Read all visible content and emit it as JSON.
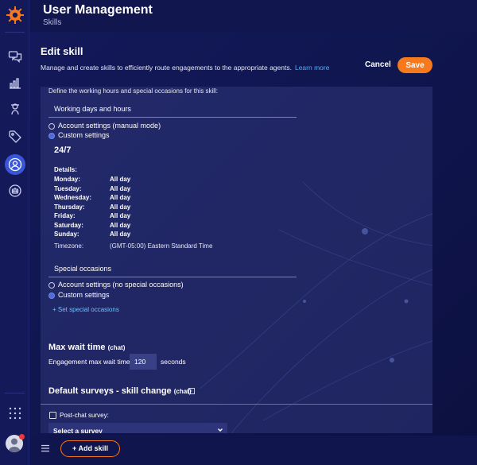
{
  "header": {
    "title": "User Management",
    "subtitle": "Skills"
  },
  "edit": {
    "title": "Edit skill",
    "description": "Manage and create skills to efficiently route engagements to the appropriate agents.",
    "learn_more": "Learn more",
    "cancel_label": "Cancel",
    "save_label": "Save"
  },
  "working_hours": {
    "intro": "Define the working hours and special occasions for this skill:",
    "heading": "Working days and hours",
    "option_account": "Account settings (manual mode)",
    "option_custom": "Custom settings",
    "summary": "24/7",
    "details_label": "Details:",
    "days": [
      {
        "day": "Monday:",
        "value": "All day"
      },
      {
        "day": "Tuesday:",
        "value": "All day"
      },
      {
        "day": "Wednesday:",
        "value": "All day"
      },
      {
        "day": "Thursday:",
        "value": "All day"
      },
      {
        "day": "Friday:",
        "value": "All day"
      },
      {
        "day": "Saturday:",
        "value": "All day"
      },
      {
        "day": "Sunday:",
        "value": "All day"
      }
    ],
    "timezone_label": "Timezone:",
    "timezone_value": "(GMT-05:00) Eastern Standard Time"
  },
  "special_occasions": {
    "heading": "Special occasions",
    "option_account": "Account settings (no special occasions)",
    "option_custom": "Custom settings",
    "set_link": "+ Set special occasions"
  },
  "max_wait": {
    "heading": "Max wait time",
    "tag": "(chat)",
    "label": "Engagement max wait time",
    "value": "120",
    "unit": "seconds"
  },
  "surveys": {
    "heading": "Default surveys - skill change",
    "tag": "(chat)",
    "info_icon": "i",
    "post_chat_label": "Post-chat survey:",
    "select_value": "Select a survey"
  },
  "footer": {
    "add_skill": "+ Add skill"
  },
  "colors": {
    "accent": "#f7791d",
    "link": "#47b1ff",
    "background": "#10164f",
    "active": "#3a56d8"
  },
  "icons": [
    "logo-icon",
    "chat-icon",
    "bar-chart-icon",
    "agent-icon",
    "tag-icon",
    "users-icon",
    "bot-icon",
    "grid-icon",
    "avatar",
    "menu-icon",
    "chevron-down-icon",
    "info-icon"
  ]
}
